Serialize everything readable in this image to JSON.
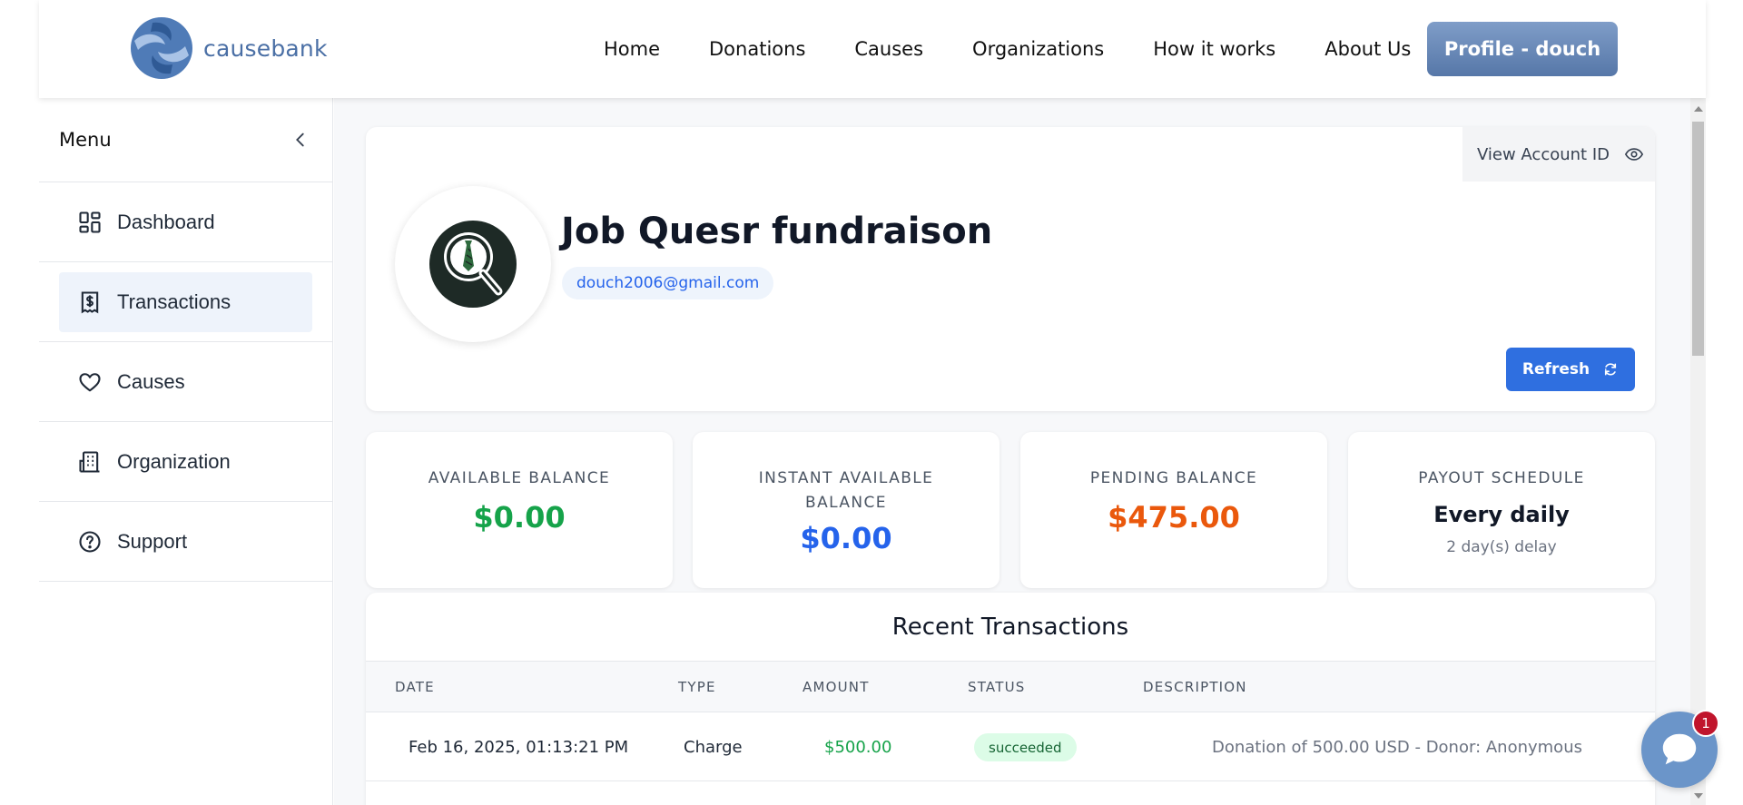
{
  "brand": {
    "name": "causebank",
    "logo_icon": "hands-globe-logo"
  },
  "nav": {
    "links": [
      "Home",
      "Donations",
      "Causes",
      "Organizations",
      "How it works",
      "About Us"
    ],
    "profile_label": "Profile - douch"
  },
  "sidebar": {
    "title": "Menu",
    "collapse_icon": "chevron-left-icon",
    "items": [
      {
        "label": "Dashboard",
        "icon": "dashboard-icon",
        "active": false
      },
      {
        "label": "Transactions",
        "icon": "receipt-dollar-icon",
        "active": true
      },
      {
        "label": "Causes",
        "icon": "heart-icon",
        "active": false
      },
      {
        "label": "Organization",
        "icon": "building-icon",
        "active": false
      },
      {
        "label": "Support",
        "icon": "help-circle-icon",
        "active": false
      }
    ]
  },
  "profile": {
    "view_account_id_label": "View Account ID",
    "name": "Job Quesr fundraison",
    "email": "douch2006@gmail.com",
    "refresh_label": "Refresh"
  },
  "stats": {
    "available": {
      "label": "AVAILABLE BALANCE",
      "value": "$0.00",
      "color": "#16a34a"
    },
    "instant": {
      "label": "INSTANT AVAILABLE BALANCE",
      "value": "$0.00",
      "color": "#2563eb"
    },
    "pending": {
      "label": "PENDING BALANCE",
      "value": "$475.00",
      "color": "#ea580c"
    },
    "payout": {
      "label": "PAYOUT SCHEDULE",
      "value": "Every daily",
      "delay": "2 day(s) delay"
    }
  },
  "transactions": {
    "title": "Recent Transactions",
    "columns": [
      "DATE",
      "TYPE",
      "AMOUNT",
      "STATUS",
      "DESCRIPTION"
    ],
    "rows": [
      {
        "date": "Feb 16, 2025, 01:13:21 PM",
        "type": "Charge",
        "amount": "$500.00",
        "status": "succeeded",
        "description": "Donation of 500.00 USD - Donor: Anonymous"
      }
    ]
  },
  "chat": {
    "unread_count": "1"
  },
  "colors": {
    "accent": "#2f6fe0",
    "brand": "#5677a8",
    "success": "#16a34a"
  }
}
